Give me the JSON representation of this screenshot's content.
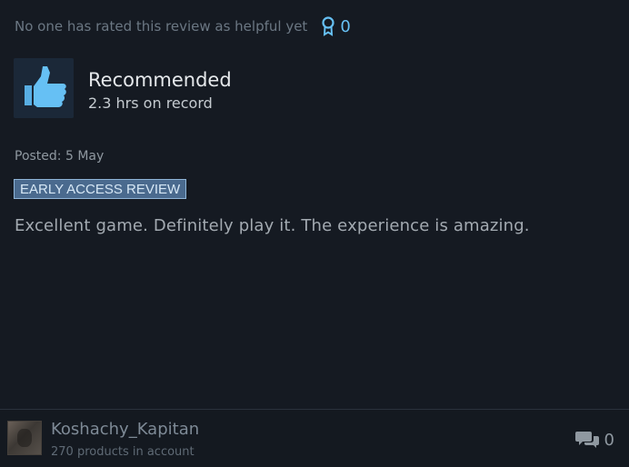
{
  "helpful": {
    "text": "No one has rated this review as helpful yet",
    "award_count": "0",
    "award_icon": "award-ribbon-icon"
  },
  "recommendation": {
    "icon": "thumbs-up-icon",
    "title": "Recommended",
    "hours": "2.3 hrs on record"
  },
  "posted": "Posted: 5 May",
  "badge": "EARLY ACCESS REVIEW",
  "review_text": "Excellent game. Definitely play it. The experience is amazing.",
  "author": {
    "name": "Koshachy_Kapitan",
    "products": "270 products in account"
  },
  "comments": {
    "icon": "comment-bubbles-icon",
    "count": "0"
  },
  "colors": {
    "background": "#151a22",
    "accent": "#66c0f4",
    "badge_bg": "#4a6a8e"
  }
}
